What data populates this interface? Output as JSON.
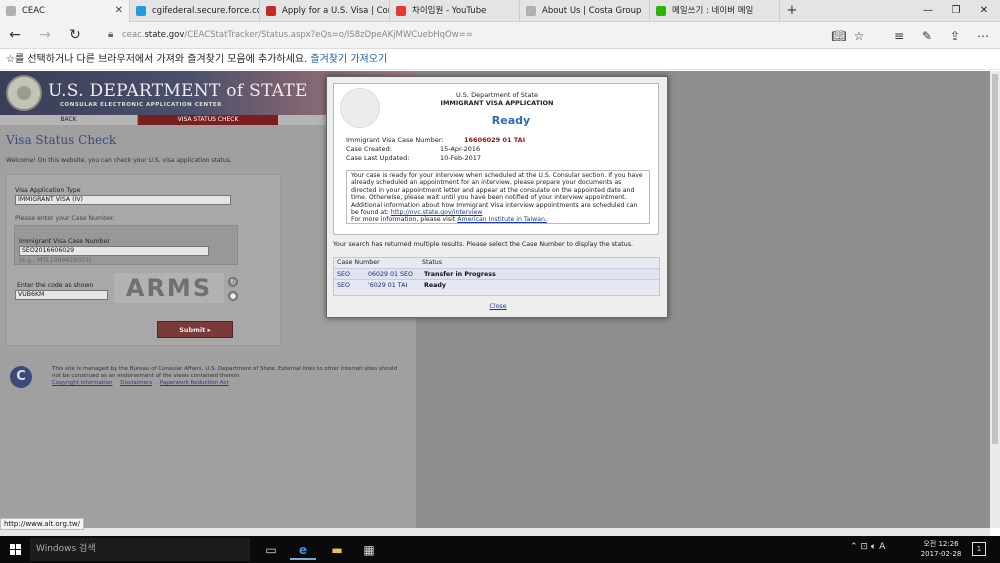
{
  "tabs": [
    {
      "label": "CEAC",
      "favicon_color": "#b0b0b0"
    },
    {
      "label": "cgifederal.secure.force.com",
      "favicon_color": "#1f9ce0"
    },
    {
      "label": "Apply for a U.S. Visa | Conta",
      "favicon_color": "#c62828"
    },
    {
      "label": "차이임원 - YouTube",
      "favicon_color": "#e53935"
    },
    {
      "label": "About Us | Costa Group",
      "favicon_color": "#b0b0b0"
    },
    {
      "label": "메일쓰기 : 네이버 메일",
      "favicon_color": "#2db400"
    }
  ],
  "address": {
    "prefix": "ceac.",
    "domain": "state.gov",
    "path": "/CEACStatTracker/Status.aspx?eQs=o/IS8zDpeAKjMWCuebHqOw=="
  },
  "favorites_bar": {
    "text": "☆를 선택하거나 다른 브라우저에서 가져와 즐겨찾기 모음에 추가하세요. ",
    "link": "즐겨찾기 가져오기"
  },
  "ceac": {
    "dept_title": "U.S. DEPARTMENT of STATE",
    "dept_sub": "CONSULAR ELECTRONIC APPLICATION CENTER",
    "back": "BACK",
    "visa_status_check_tab": "VISA STATUS CHECK",
    "page_title": "Visa Status Check",
    "welcome": "Welcome! On this website, you can check your U.S. visa application status.",
    "form": {
      "app_type_label": "Visa Application Type",
      "app_type_value": "IMMIGRANT VISA (IV)",
      "enter_case": "Please enter your Case Number.",
      "case_label": "Immigrant Visa Case Number",
      "case_value": "SEO2016606029",
      "case_example": "(e.g., MTL1999626023)",
      "code_label": "Enter the code as shown",
      "code_value": "VUB6KM",
      "captcha_text": "ARMS",
      "submit": "Submit"
    },
    "footer": {
      "c_logo": "C",
      "text": "This site is managed by the Bureau of Consular Affairs, U.S. Department of State. External links to other Internet sites should not be construed as an endorsement of the views contained therein.",
      "links": [
        "Copyright Information",
        "Disclaimers",
        "Paperwork Reduction Act"
      ]
    }
  },
  "modal": {
    "dept": "U.S. Department of State",
    "app": "IMMIGRANT VISA APPLICATION",
    "status": "Ready",
    "case_number_label": "Immigrant Visa Case Number:",
    "case_number_value": "16606029 01 TAI",
    "created_label": "Case Created:",
    "created_value": "15-Apr-2016",
    "updated_label": "Case Last Updated:",
    "updated_value": "10-Feb-2017",
    "message": "Your case is ready for your interview when scheduled at the U.S. Consular section. If you have already scheduled an appointment for an interview, please prepare your documents as directed in your appointment letter and appear at the consulate on the appointed date and time. Otherwise, please wait until you have been notified of your interview appointment. Additional information about how Immigrant Visa interview appointments are scheduled can be found at: ",
    "message_link": "http://nvc.state.gov/interview",
    "more_info": "For more information, please visit ",
    "more_info_link": "American Institute in Taiwan.",
    "multi_results": "Your search has returned multiple results. Please select the Case Number to display the status.",
    "table": {
      "headers": [
        "Case Number",
        "Status"
      ],
      "rows": [
        {
          "post": "SEO",
          "case": "06029 01 SEO",
          "status": "Transfer in Progress"
        },
        {
          "post": "SEO",
          "case": "'6029 01 TAI",
          "status": "Ready"
        }
      ]
    },
    "close": "Close"
  },
  "status_url": "http://www.ait.org.tw/",
  "taskbar": {
    "search_placeholder": "Windows 검색",
    "time": "오전 12:26",
    "date": "2017-02-28",
    "notification_count": "1"
  }
}
